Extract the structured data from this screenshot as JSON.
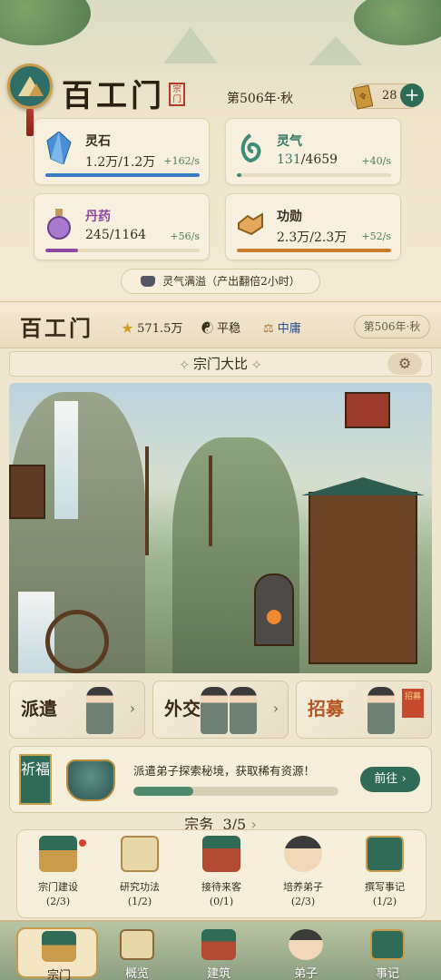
{
  "sect": {
    "name": "百工门",
    "seal": "宗门",
    "date": "第506年·秋",
    "token_count": "28",
    "token_glyph": "令",
    "add_symbol": "+"
  },
  "resources": [
    {
      "name": "灵石",
      "value": "1.2万/1.2万",
      "rate": "+162/s",
      "fill": 1.0,
      "color": "#3a7cc6",
      "icon": "crystal-icon"
    },
    {
      "name": "灵气",
      "value_a": "131",
      "value_b": "/4659",
      "rate": "+40/s",
      "fill": 0.03,
      "color": "#3c8c78",
      "icon": "spirit-swirl-icon"
    },
    {
      "name": "丹药",
      "value": "245/1164",
      "rate": "+56/s",
      "fill": 0.21,
      "color": "#8e4aa3",
      "icon": "potion-icon"
    },
    {
      "name": "功勋",
      "value": "2.3万/2.3万",
      "rate": "+52/s",
      "fill": 1.0,
      "color": "#c77d2a",
      "icon": "handshake-icon"
    }
  ],
  "status_pill": "灵气满溢（产出翻倍2小时）",
  "band": {
    "title": "百工门",
    "prestige": "571.5万",
    "stability": "平稳",
    "alignment": "中庸",
    "date": "第506年·秋"
  },
  "contest": {
    "label": "宗门大比",
    "deco_left": "⟡",
    "deco_right": "⟡"
  },
  "actions": [
    {
      "label": "派遣"
    },
    {
      "label": "外交"
    },
    {
      "label": "招募",
      "banner": "招募"
    }
  ],
  "quest": {
    "tag": "祈福",
    "text": "派遣弟子探索秘境，获取稀有资源！",
    "progress": 0.29,
    "button": "前往 ›"
  },
  "tasks": {
    "header": "宗务",
    "count": "3/5",
    "items": [
      {
        "label": "宗门建设",
        "count": "(2/3)",
        "alert": true
      },
      {
        "label": "研究功法",
        "count": "(1/2)",
        "alert": false
      },
      {
        "label": "接待来客",
        "count": "(0/1)",
        "alert": false
      },
      {
        "label": "培养弟子",
        "count": "(2/3)",
        "alert": false
      },
      {
        "label": "撰写事记",
        "count": "(1/2)",
        "alert": false
      }
    ]
  },
  "nav": [
    {
      "label": "宗门",
      "active": true
    },
    {
      "label": "概览"
    },
    {
      "label": "建筑"
    },
    {
      "label": "弟子"
    },
    {
      "label": "事记"
    }
  ],
  "colors": {
    "primary_green": "#2f6b57",
    "gold": "#c99b4a",
    "alert_red": "#d8442f"
  }
}
